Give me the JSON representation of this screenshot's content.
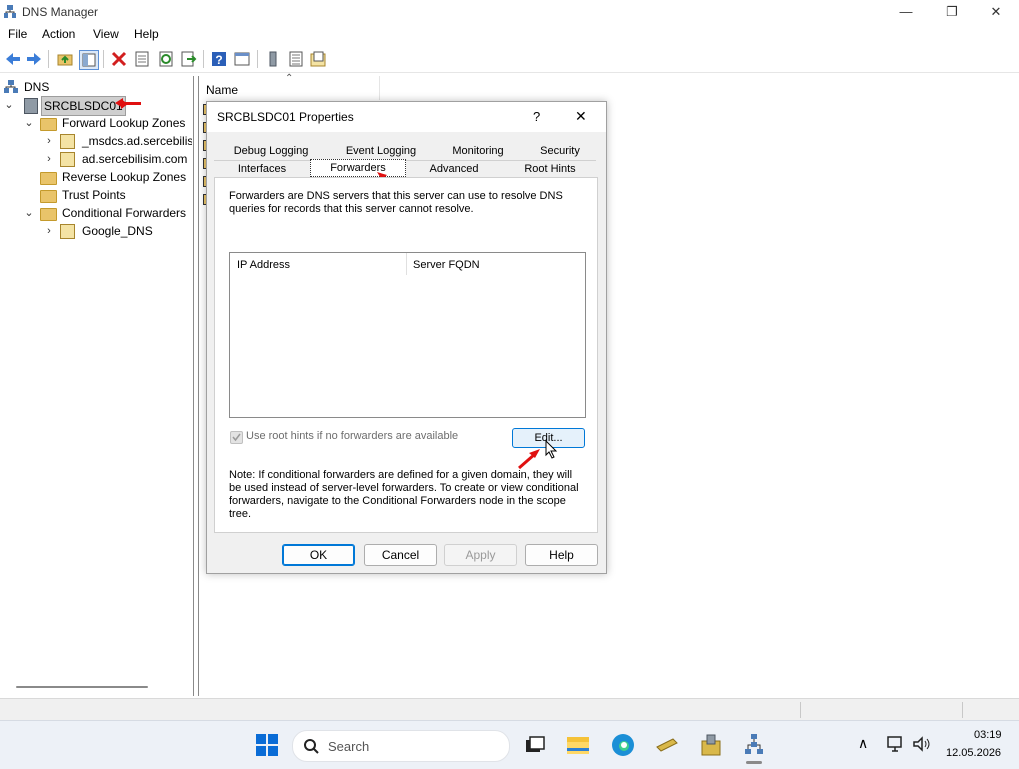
{
  "window": {
    "title": "DNS Manager",
    "minimize": "—",
    "maximize": "❐",
    "close": "✕"
  },
  "menu": [
    "File",
    "Action",
    "View",
    "Help"
  ],
  "tree": {
    "root": "DNS",
    "server": "SRCBLSDC01",
    "items": [
      {
        "label": "Forward Lookup Zones"
      },
      {
        "label": "_msdcs.ad.sercebilisim"
      },
      {
        "label": "ad.sercebilisim.com"
      },
      {
        "label": "Reverse Lookup Zones"
      },
      {
        "label": "Trust Points"
      },
      {
        "label": "Conditional Forwarders"
      },
      {
        "label": "Google_DNS"
      }
    ]
  },
  "list": {
    "column_name": "Name"
  },
  "dialog": {
    "title": "SRCBLSDC01 Properties",
    "help": "?",
    "close": "✕",
    "tabs_row1": [
      "Debug Logging",
      "Event Logging",
      "Monitoring",
      "Security"
    ],
    "tabs_row2": [
      "Interfaces",
      "Forwarders",
      "Advanced",
      "Root Hints"
    ],
    "selected_tab": "Forwarders",
    "description": "Forwarders are DNS servers that this server can use to resolve DNS queries for records that this server cannot resolve.",
    "table": {
      "headers": [
        "IP Address",
        "Server FQDN"
      ],
      "rows": []
    },
    "root_hints_checkbox": "Use root hints if no forwarders are available",
    "edit_button": "Edit...",
    "note": "Note: If conditional forwarders are defined for a given domain, they will be used instead of server-level forwarders.  To create or view conditional forwarders, navigate to the Conditional Forwarders node in the scope tree.",
    "buttons": {
      "ok": "OK",
      "cancel": "Cancel",
      "apply": "Apply",
      "help": "Help"
    }
  },
  "taskbar": {
    "search_placeholder": "Search",
    "time": "03:19",
    "date": "12.05.2026"
  },
  "colors": {
    "accent": "#0067c0",
    "annotation_arrow": "#e01010"
  }
}
